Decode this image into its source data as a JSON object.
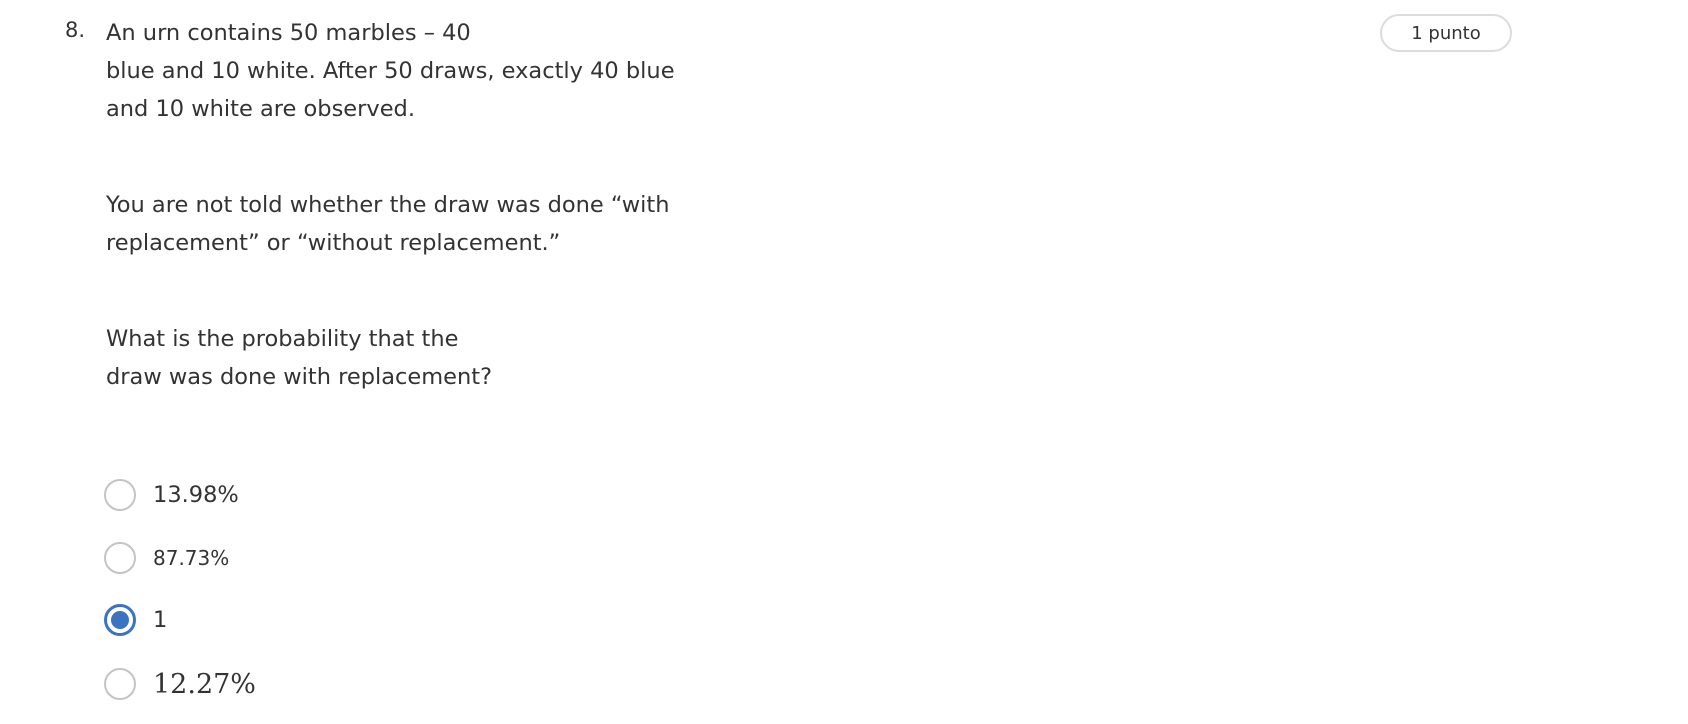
{
  "question": {
    "number": "8.",
    "points": "1 punto",
    "paragraphs": [
      {
        "lines": [
          "An urn contains 50 marbles – 40",
          "blue and 10 white. After 50 draws, exactly 40 blue",
          "and 10 white are observed."
        ]
      },
      {
        "lines": [
          "You are not told whether the draw was done “with",
          "replacement” or “without replacement.”"
        ]
      },
      {
        "lines": [
          "What is the probability that the",
          "draw was done with replacement?"
        ]
      }
    ],
    "options": [
      {
        "label": "13.98%",
        "selected": false
      },
      {
        "label": "87.73%",
        "selected": false
      },
      {
        "label": "1",
        "selected": true
      },
      {
        "label": "12.27%",
        "selected": false
      }
    ],
    "accent_color": "#3b73c2"
  }
}
